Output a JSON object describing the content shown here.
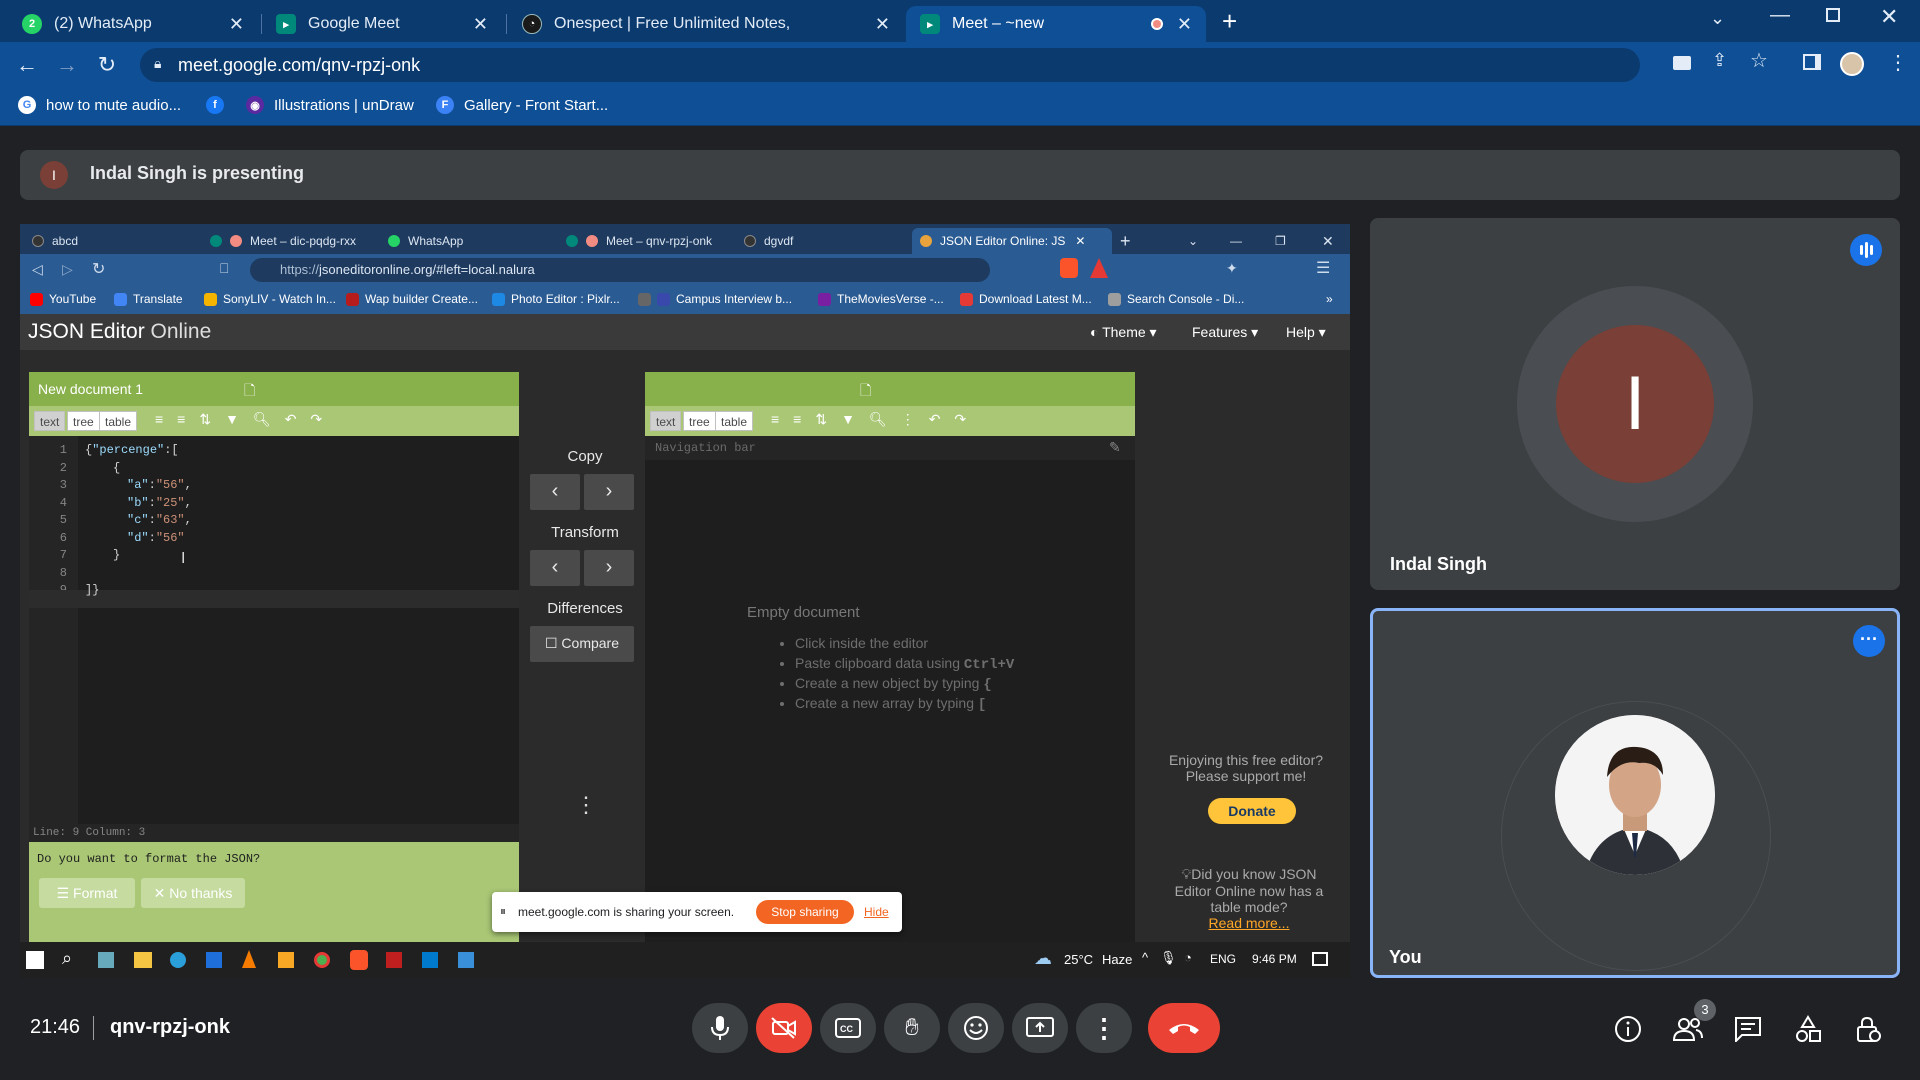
{
  "browser": {
    "tabs": [
      {
        "title": "(2) WhatsApp",
        "icon": "whatsapp-icon",
        "color": "#25d366"
      },
      {
        "title": "Google Meet",
        "icon": "meet-icon",
        "color": "#00897b"
      },
      {
        "title": "Onespect | Free Unlimited Notes,",
        "icon": "onespect-icon",
        "color": "#1a1a1a"
      },
      {
        "title": "Meet – ~new",
        "icon": "meet-icon",
        "color": "#00897b"
      }
    ],
    "url": "meet.google.com/qnv-rpzj-onk",
    "bookmarks": [
      "how to mute audio...",
      "Illustrations | unDraw",
      "Gallery - Front Start..."
    ]
  },
  "meet": {
    "presenting_banner": "Indal Singh is presenting",
    "presenter_initial": "I",
    "time": "21:46",
    "meeting_code": "qnv-rpzj-onk",
    "participant_count": "3",
    "tiles": [
      {
        "name": "Indal Singh",
        "initial": "I",
        "avatar_color": "#7a3f36"
      },
      {
        "name": "You"
      }
    ]
  },
  "shared_screen": {
    "tabs": [
      "abcd",
      "Meet – dic-pqdg-rxx",
      "WhatsApp",
      "Meet – qnv-rpzj-onk",
      "dgvdf",
      "JSON Editor Online: JS"
    ],
    "url_prefix": "https://",
    "url": "jsoneditoronline.org/#left=local.nalura",
    "bookmarks": [
      "YouTube",
      "Translate",
      "SonyLIV - Watch In...",
      "Wap builder Create...",
      "Photo Editor : Pixlr...",
      "Campus Interview b...",
      "TheMoviesVerse -...",
      "Download Latest M...",
      "Search Console - Di..."
    ],
    "app": {
      "title_bold": "JSON Editor",
      "title_light": "Online",
      "menu": [
        "Theme",
        "Features",
        "Help"
      ]
    },
    "left_panel": {
      "title": "New document 1",
      "modes": [
        "text",
        "tree",
        "table"
      ],
      "line_numbers": [
        "1",
        "2",
        "3",
        "4",
        "5",
        "6",
        "7",
        "8",
        "9"
      ],
      "status": "Line: 9   Column: 3",
      "format_prompt": "Do you want to format the JSON?",
      "format_button": "Format",
      "no_thanks_button": "No thanks",
      "code": {
        "l1_open": "{",
        "l1_key": "\"percenge\"",
        "l1_rest": ":[",
        "l2": "{",
        "pairs": [
          {
            "k": "\"a\"",
            "v": "\"56\"",
            "t": ","
          },
          {
            "k": "\"b\"",
            "v": "\"25\"",
            "t": ","
          },
          {
            "k": "\"c\"",
            "v": "\"63\"",
            "t": ","
          },
          {
            "k": "\"d\"",
            "v": "\"56\"",
            "t": ""
          }
        ],
        "l7": "}",
        "l9": "]}"
      }
    },
    "middle": {
      "copy": "Copy",
      "transform": "Transform",
      "differences": "Differences",
      "compare": "Compare"
    },
    "right_panel": {
      "modes": [
        "text",
        "tree",
        "table"
      ],
      "navigation_bar": "Navigation bar",
      "empty_title": "Empty document",
      "tips": [
        {
          "text": "Click inside the editor",
          "code": ""
        },
        {
          "text": "Paste clipboard data using ",
          "code": "Ctrl+V"
        },
        {
          "text": "Create a new object by typing ",
          "code": "{"
        },
        {
          "text": "Create a new array by typing ",
          "code": "["
        }
      ]
    },
    "ad": {
      "line1": "Enjoying this free editor?",
      "line2": "Please support me!",
      "donate": "Donate",
      "tip": "Did you know JSON Editor Online now has a table mode?",
      "read_more": "Read more..."
    },
    "share_bar": {
      "text": "meet.google.com is sharing your screen.",
      "stop": "Stop sharing",
      "hide": "Hide"
    },
    "taskbar": {
      "weather": "25°C",
      "condition": "Haze",
      "lang": "ENG",
      "time": "9:46 PM"
    }
  },
  "colors": {
    "meet_bg": "#202124",
    "tile_bg": "#3c4043",
    "end_call": "#ea4335",
    "chrome_blue": "#0f4f96",
    "jse_green": "#88b04b",
    "focus_border": "#8ab4f8"
  }
}
